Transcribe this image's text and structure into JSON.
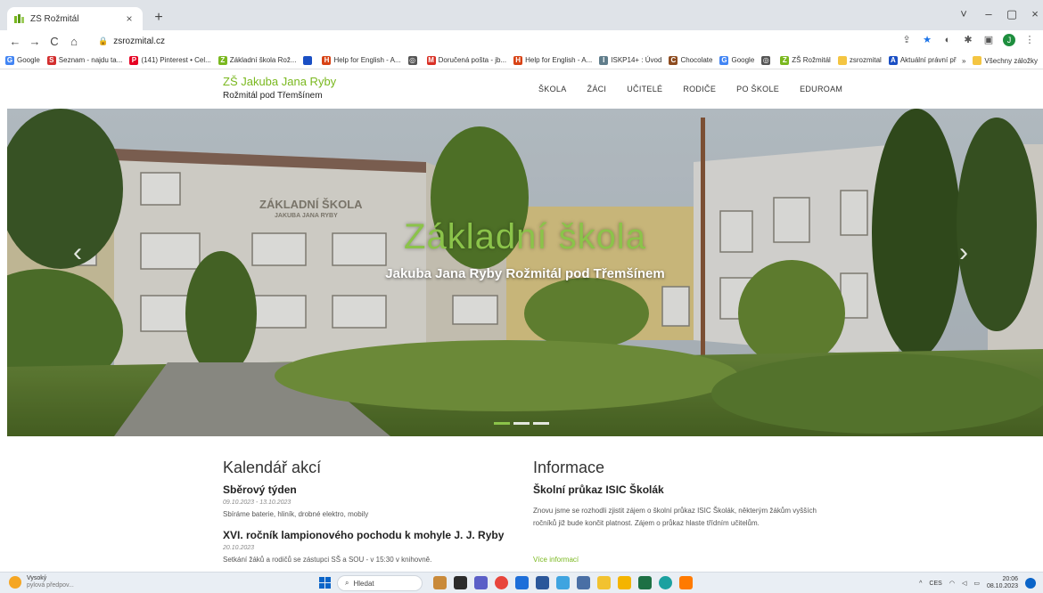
{
  "browser": {
    "tab_title": "ZŠ Rožmitál",
    "tab_close": "×",
    "new_tab": "+",
    "address": "zsrozmital.cz",
    "nav": {
      "back": "←",
      "forward": "→",
      "reload": "C",
      "home": "⌂"
    },
    "window": {
      "minimize": "–",
      "maximize": "▢",
      "close": "×",
      "tabsearch": "˅"
    },
    "bookmarks": [
      {
        "label": "Google",
        "icon": "G",
        "color": "#4285f4"
      },
      {
        "label": "Seznam - najdu ta...",
        "icon": "S",
        "color": "#d32f2f"
      },
      {
        "label": "(141) Pinterest • Cel...",
        "icon": "P",
        "color": "#e60023"
      },
      {
        "label": "Základní škola Rož...",
        "icon": "Z",
        "color": "#7ab81f"
      },
      {
        "label": "",
        "icon": "",
        "color": "#1a4fc4"
      },
      {
        "label": "Help for English - A...",
        "icon": "H",
        "color": "#d84315"
      },
      {
        "label": "",
        "icon": "◎",
        "color": "#555555"
      },
      {
        "label": "Doručená pošta - jb...",
        "icon": "M",
        "color": "#d93025"
      },
      {
        "label": "Help for English - A...",
        "icon": "H",
        "color": "#d84315"
      },
      {
        "label": "ISKP14+ : Úvod",
        "icon": "I",
        "color": "#607d8b"
      },
      {
        "label": "Chocolate",
        "icon": "C",
        "color": "#8d4b1f"
      },
      {
        "label": "Google",
        "icon": "G",
        "color": "#4285f4"
      },
      {
        "label": "",
        "icon": "◎",
        "color": "#555555"
      },
      {
        "label": "ZŠ Rožmitál",
        "icon": "Z",
        "color": "#7ab81f"
      },
      {
        "label": "zsrozmital",
        "icon": "",
        "color": "#f4c542"
      },
      {
        "label": "Aktuální právní pře...",
        "icon": "A",
        "color": "#1a4fc4"
      }
    ],
    "bookmarks_more": "»",
    "all_bookmarks": "Všechny záložky"
  },
  "site": {
    "brand_name": "ZŠ Jakuba Jana Ryby",
    "brand_place": "Rožmitál pod Třemšínem",
    "nav": [
      "ŠKOLA",
      "ŽÁCI",
      "UČITELÉ",
      "RODIČE",
      "PO ŠKOLE",
      "EDUROAM"
    ],
    "hero_title": "Základní škola",
    "hero_subtitle": "Jakuba Jana Ryby Rožmitál pod Třemšínem",
    "building_sign_1": "ZÁKLADNÍ ŠKOLA",
    "building_sign_2": "JAKUBA JANA RYBY",
    "arrow_prev": "‹",
    "arrow_next": "›"
  },
  "calendar": {
    "title": "Kalendář akcí",
    "events": [
      {
        "title": "Sběrový týden",
        "date": "09.10.2023 - 13.10.2023",
        "text": "Sbíráme baterie, hliník, drobné elektro, mobily"
      },
      {
        "title": "XVI. ročník lampionového pochodu k mohyle J. J. Ryby",
        "date": "20.10.2023",
        "text": "Setkání žáků a rodičů se zástupci SŠ a SOU - v 15:30 v knihovně."
      }
    ]
  },
  "info": {
    "title": "Informace",
    "item_title": "Školní průkaz ISIC Školák",
    "item_text": "Znovu jsme se rozhodli zjistit zájem o školní průkaz ISIC Školák, některým žákům vyšších ročníků již bude končit platnost. Zájem o průkaz hlaste třídním učitelům.",
    "more_link": "Více informací"
  },
  "taskbar": {
    "weather_1": "Vysoký",
    "weather_2": "pylová předpov...",
    "search": "Hledat",
    "lang": "CES",
    "time": "20:06",
    "date": "08.10.2023"
  }
}
